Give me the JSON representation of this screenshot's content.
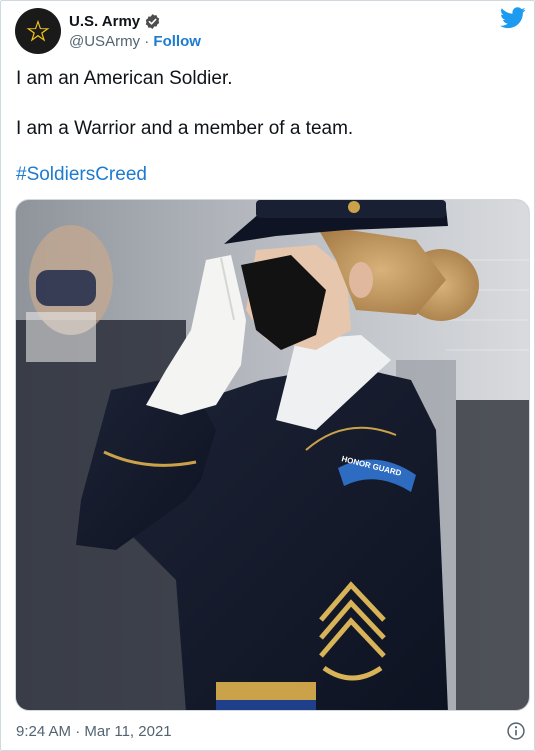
{
  "author": {
    "display_name": "U.S. Army",
    "handle": "@USArmy",
    "separator": "·",
    "follow_label": "Follow"
  },
  "tweet": {
    "lines": [
      "I am an American Soldier.",
      "I am a Warrior and a member of a team."
    ],
    "hashtag": "#SoldiersCreed"
  },
  "media": {
    "patch_text": "HONOR GUARD"
  },
  "footer": {
    "timestamp": "9:24 AM · Mar 11, 2021"
  },
  "icons": {
    "avatar": "army-star-icon",
    "verified": "verified-badge-icon",
    "brand": "twitter-bird-icon",
    "info": "info-icon"
  },
  "colors": {
    "link": "#1d7bd0",
    "text": "#0f1419",
    "muted": "#536471",
    "twitter_blue": "#1d9bf0",
    "army_gold": "#f2c318"
  }
}
